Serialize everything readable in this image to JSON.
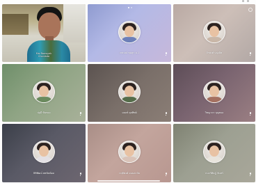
{
  "status_bar": {
    "icons": [
      "signal-dot-icon",
      "battery-dot-icon"
    ]
  },
  "camera_tile": {
    "name": "Mai Romsyek",
    "subtitle": "Chonlada",
    "mic_icon": "mic-icon"
  },
  "participants": [
    {
      "name": "เกษมณ์ ชุมสุก ม.1",
      "bg": "linear-gradient(135deg,#8f9bd0 0%,#b3b9e6 40%,#c7b8da 100%)",
      "shirt": "#6c7fb8",
      "mic_icon": "mic-icon"
    },
    {
      "name": "จิรพงศ์ บุญเลิศ",
      "bg": "linear-gradient(135deg,#b9a9a3 0%,#cdbfb8 45%,#b2a8a5 100%)",
      "shirt": "#c9b7a8",
      "mic_icon": "mic-icon"
    },
    {
      "name": "ปฐมี ขันทอง",
      "bg": "linear-gradient(135deg,#6f8f6a 0%,#8fa484 45%,#a9b19a 100%)",
      "shirt": "#6b8a5e",
      "mic_icon": "mic-icon"
    },
    {
      "name": "มณฑ์ ดุลทิพย์",
      "bg": "linear-gradient(135deg,#5b5350 0%,#7a6f69 50%,#8b7e76 100%)",
      "shirt": "#556c4a",
      "mic_icon": "mic-icon"
    },
    {
      "name": "วิชญาดา บุญทอง",
      "bg": "linear-gradient(135deg,#5d4d57 0%,#7a6470 45%,#9b7f83 100%)",
      "shirt": "#a47060",
      "mic_icon": "mic-icon"
    },
    {
      "name": "ธิติพัฒน์ สพนันท์ผล",
      "bg": "linear-gradient(135deg,#3b3f49 0%,#5a5a66 45%,#6d6670 100%)",
      "shirt": "#e3e0e4",
      "mic_icon": "mic-icon"
    },
    {
      "name": "กฤติพงศ์ อ่อนละมัย",
      "bg": "linear-gradient(135deg,#a98e87 0%,#c3a59d 45%,#b89790 100%)",
      "shirt": "#d9c3b8",
      "mic_icon": "mic-icon"
    },
    {
      "name": "กนกวิศิษฎ์ จันทร์",
      "bg": "linear-gradient(135deg,#7f8272 0%,#9da092 45%,#a9a79a 100%)",
      "shirt": "#e8e4dc",
      "mic_icon": "mic-icon"
    }
  ],
  "top_controls": {
    "page_indicator_icon": "page-dots-icon",
    "settings_icon": "gear-icon"
  }
}
